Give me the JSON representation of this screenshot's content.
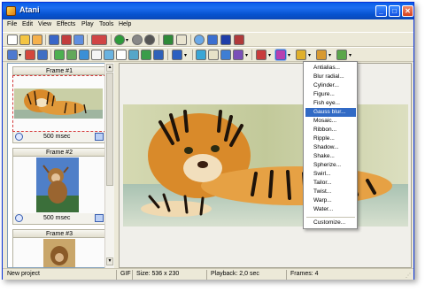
{
  "window": {
    "title": "Atani"
  },
  "menu": [
    "File",
    "Edit",
    "View",
    "Effects",
    "Play",
    "Tools",
    "Help"
  ],
  "frames": [
    {
      "title": "Frame #1",
      "delay": "500 msec",
      "selected": true
    },
    {
      "title": "Frame #2",
      "delay": "500 msec",
      "selected": false
    },
    {
      "title": "Frame #3",
      "delay": "",
      "selected": false
    }
  ],
  "effects_menu": {
    "items": [
      "Antialias...",
      "Blur radial...",
      "Cylinder...",
      "Figure...",
      "Fish eye...",
      "Gauss blur...",
      "Mosaic...",
      "Ribbon...",
      "Ripple...",
      "Shadow...",
      "Shake...",
      "Spherize...",
      "Swirl...",
      "Tailor...",
      "Twist...",
      "Warp...",
      "Water...",
      "Customize..."
    ],
    "highlighted": "Gauss blur..."
  },
  "status": {
    "message": "New project",
    "format": "GIF",
    "size": "Size: 536 x 230",
    "playback": "Playback: 2,0 sec",
    "frames": "Frames: 4"
  },
  "colors": {
    "accent": "#316ac5",
    "titlebar": "#0a5fe8"
  }
}
